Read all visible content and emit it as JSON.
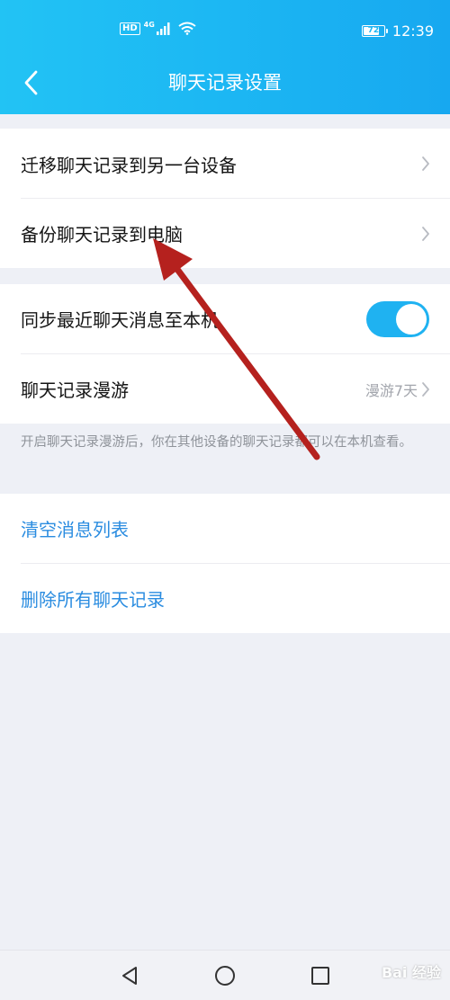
{
  "status_bar": {
    "hd_label": "HD",
    "network_label": "4G",
    "battery_level": "72",
    "time": "12:39"
  },
  "header": {
    "title": "聊天记录设置"
  },
  "section1": {
    "items": [
      {
        "label": "迁移聊天记录到另一台设备"
      },
      {
        "label": "备份聊天记录到电脑"
      }
    ]
  },
  "section2": {
    "sync_label": "同步最近聊天消息至本机",
    "sync_enabled": true,
    "roaming_label": "聊天记录漫游",
    "roaming_value": "漫游7天",
    "hint": "开启聊天记录漫游后，你在其他设备的聊天记录都可以在本机查看。"
  },
  "section3": {
    "clear_label": "清空消息列表",
    "delete_label": "删除所有聊天记录"
  },
  "watermark": "Bai 经验",
  "colors": {
    "header_start": "#22c3f4",
    "header_end": "#17a8f0",
    "toggle_on": "#1fb2f1",
    "link_blue": "#2a8ce0",
    "annotation_arrow": "#b5211e"
  },
  "icons": {
    "back": "chevron-left-icon",
    "row_chevron": "chevron-right-icon",
    "nav_back": "triangle-back-icon",
    "nav_home": "circle-home-icon",
    "nav_recent": "square-recent-icon"
  }
}
